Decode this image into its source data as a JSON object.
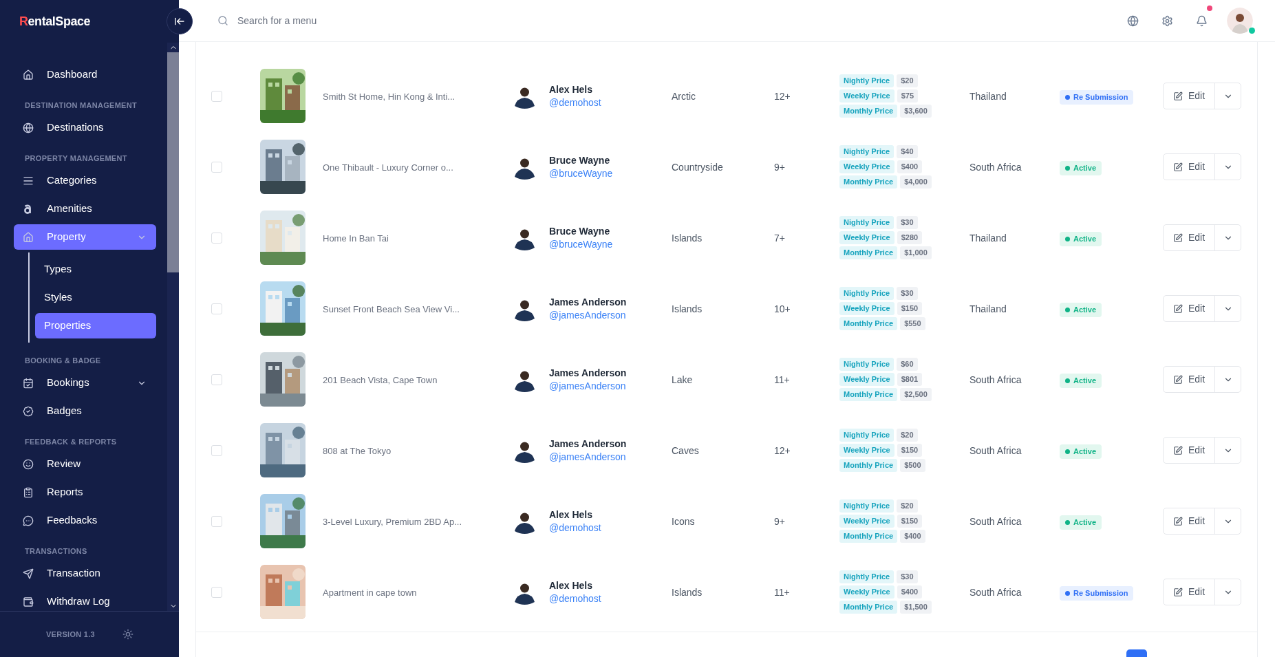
{
  "brand": {
    "name": "RentalSpace"
  },
  "search": {
    "placeholder": "Search for a menu"
  },
  "header": {
    "unread_notifications": true,
    "user_online": true
  },
  "sidebar": {
    "items": [
      {
        "kind": "link",
        "label": "Dashboard",
        "selected": false,
        "dropdown": false
      },
      {
        "kind": "section",
        "label": "DESTINATION MANAGEMENT"
      },
      {
        "kind": "link",
        "label": "Destinations",
        "selected": false,
        "dropdown": false
      },
      {
        "kind": "section",
        "label": "PROPERTY MANAGEMENT"
      },
      {
        "kind": "link",
        "label": "Categories",
        "selected": false,
        "dropdown": false
      },
      {
        "kind": "link",
        "label": "Amenities",
        "selected": false,
        "dropdown": false
      },
      {
        "kind": "link",
        "label": "Property",
        "selected": true,
        "dropdown": true,
        "children": [
          {
            "label": "Types",
            "selected": false
          },
          {
            "label": "Styles",
            "selected": false
          },
          {
            "label": "Properties",
            "selected": true
          }
        ]
      },
      {
        "kind": "section",
        "label": "BOOKING & BADGE"
      },
      {
        "kind": "link",
        "label": "Bookings",
        "selected": false,
        "dropdown": true
      },
      {
        "kind": "link",
        "label": "Badges",
        "selected": false,
        "dropdown": false
      },
      {
        "kind": "section",
        "label": "FEEDBACK & REPORTS"
      },
      {
        "kind": "link",
        "label": "Review",
        "selected": false,
        "dropdown": false
      },
      {
        "kind": "link",
        "label": "Reports",
        "selected": false,
        "dropdown": false
      },
      {
        "kind": "link",
        "label": "Feedbacks",
        "selected": false,
        "dropdown": false
      },
      {
        "kind": "section",
        "label": "TRANSACTIONS"
      },
      {
        "kind": "link",
        "label": "Transaction",
        "selected": false,
        "dropdown": false
      },
      {
        "kind": "link",
        "label": "Withdraw Log",
        "selected": false,
        "dropdown": false
      }
    ],
    "version": "VERSION 1.3"
  },
  "table": {
    "rows": [
      {
        "checked": false,
        "title": "Smith St Home, Hin Kong & Inti...",
        "host_name": "Alex Hels",
        "host_handle": "@demohost",
        "category": "Arctic",
        "guests": "12+",
        "prices": [
          {
            "label": "Nightly Price",
            "value": "$20"
          },
          {
            "label": "Weekly Price",
            "value": "$75"
          },
          {
            "label": "Monthly Price",
            "value": "$3,600"
          }
        ],
        "country": "Thailand",
        "status": {
          "kind": "re_submission",
          "label": "Re Submission"
        },
        "action": "Edit"
      },
      {
        "checked": false,
        "title": "One Thibault - Luxury Corner o...",
        "host_name": "Bruce Wayne",
        "host_handle": "@bruceWayne",
        "category": "Countryside",
        "guests": "9+",
        "prices": [
          {
            "label": "Nightly Price",
            "value": "$40"
          },
          {
            "label": "Weekly Price",
            "value": "$400"
          },
          {
            "label": "Monthly Price",
            "value": "$4,000"
          }
        ],
        "country": "South Africa",
        "status": {
          "kind": "active",
          "label": "Active"
        },
        "action": "Edit"
      },
      {
        "checked": false,
        "title": "Home In Ban Tai",
        "host_name": "Bruce Wayne",
        "host_handle": "@bruceWayne",
        "category": "Islands",
        "guests": "7+",
        "prices": [
          {
            "label": "Nightly Price",
            "value": "$30"
          },
          {
            "label": "Weekly Price",
            "value": "$280"
          },
          {
            "label": "Monthly Price",
            "value": "$1,000"
          }
        ],
        "country": "Thailand",
        "status": {
          "kind": "active",
          "label": "Active"
        },
        "action": "Edit"
      },
      {
        "checked": false,
        "title": "Sunset Front Beach Sea View Vi...",
        "host_name": "James Anderson",
        "host_handle": "@jamesAnderson",
        "category": "Islands",
        "guests": "10+",
        "prices": [
          {
            "label": "Nightly Price",
            "value": "$30"
          },
          {
            "label": "Weekly Price",
            "value": "$150"
          },
          {
            "label": "Monthly Price",
            "value": "$550"
          }
        ],
        "country": "Thailand",
        "status": {
          "kind": "active",
          "label": "Active"
        },
        "action": "Edit"
      },
      {
        "checked": false,
        "title": "201 Beach Vista, Cape Town",
        "host_name": "James Anderson",
        "host_handle": "@jamesAnderson",
        "category": "Lake",
        "guests": "11+",
        "prices": [
          {
            "label": "Nightly Price",
            "value": "$60"
          },
          {
            "label": "Weekly Price",
            "value": "$801"
          },
          {
            "label": "Monthly Price",
            "value": "$2,500"
          }
        ],
        "country": "South Africa",
        "status": {
          "kind": "active",
          "label": "Active"
        },
        "action": "Edit"
      },
      {
        "checked": false,
        "title": "808 at The Tokyo",
        "host_name": "James Anderson",
        "host_handle": "@jamesAnderson",
        "category": "Caves",
        "guests": "12+",
        "prices": [
          {
            "label": "Nightly Price",
            "value": "$20"
          },
          {
            "label": "Weekly Price",
            "value": "$150"
          },
          {
            "label": "Monthly Price",
            "value": "$500"
          }
        ],
        "country": "South Africa",
        "status": {
          "kind": "active",
          "label": "Active"
        },
        "action": "Edit"
      },
      {
        "checked": false,
        "title": "3-Level Luxury, Premium 2BD Ap...",
        "host_name": "Alex Hels",
        "host_handle": "@demohost",
        "category": "Icons",
        "guests": "9+",
        "prices": [
          {
            "label": "Nightly Price",
            "value": "$20"
          },
          {
            "label": "Weekly Price",
            "value": "$150"
          },
          {
            "label": "Monthly Price",
            "value": "$400"
          }
        ],
        "country": "South Africa",
        "status": {
          "kind": "active",
          "label": "Active"
        },
        "action": "Edit"
      },
      {
        "checked": false,
        "title": "Apartment in cape town",
        "host_name": "Alex Hels",
        "host_handle": "@demohost",
        "category": "Islands",
        "guests": "11+",
        "prices": [
          {
            "label": "Nightly Price",
            "value": "$30"
          },
          {
            "label": "Weekly Price",
            "value": "$400"
          },
          {
            "label": "Monthly Price",
            "value": "$1,500"
          }
        ],
        "country": "South Africa",
        "status": {
          "kind": "re_submission",
          "label": "Re Submission"
        },
        "action": "Edit"
      }
    ]
  }
}
